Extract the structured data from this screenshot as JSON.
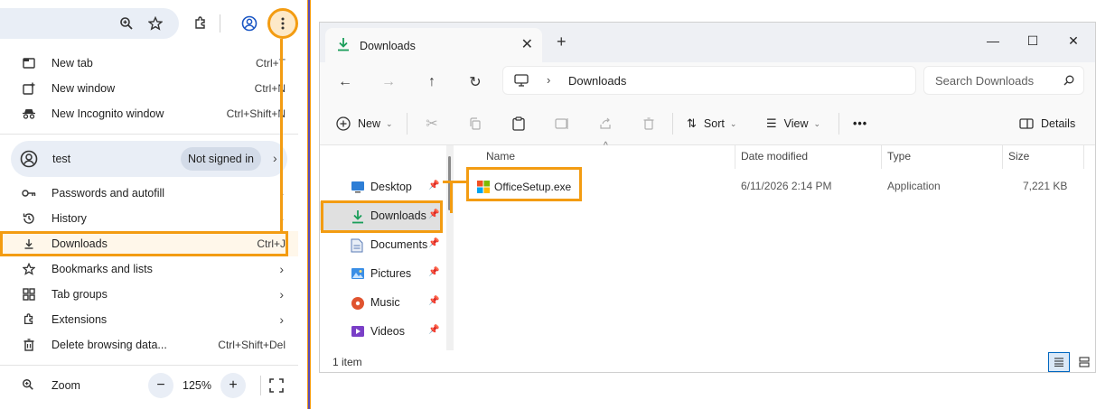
{
  "chrome": {
    "zoom": {
      "label": "Zoom",
      "value": "125%",
      "minus": "−",
      "plus": "+"
    },
    "menu_items_top": [
      {
        "label": "New tab",
        "shortcut": "Ctrl+T",
        "icon": "new-tab-icon"
      },
      {
        "label": "New window",
        "shortcut": "Ctrl+N",
        "icon": "new-window-icon"
      },
      {
        "label": "New Incognito window",
        "shortcut": "Ctrl+Shift+N",
        "icon": "incognito-icon"
      }
    ],
    "profile": {
      "name": "test",
      "status": "Not signed in",
      "icon": "profile-icon"
    },
    "menu_items": [
      {
        "label": "Passwords and autofill",
        "icon": "key-icon",
        "arrow": "›"
      },
      {
        "label": "History",
        "icon": "history-icon",
        "arrow": "›"
      },
      {
        "label": "Downloads",
        "shortcut": "Ctrl+J",
        "icon": "download-icon",
        "highlighted": true
      },
      {
        "label": "Bookmarks and lists",
        "icon": "star-icon",
        "arrow": "›"
      },
      {
        "label": "Tab groups",
        "icon": "tab-groups-icon",
        "arrow": "›"
      },
      {
        "label": "Extensions",
        "icon": "extensions-icon",
        "arrow": "›"
      },
      {
        "label": "Delete browsing data...",
        "shortcut": "Ctrl+Shift+Del",
        "icon": "trash-icon"
      }
    ]
  },
  "explorer": {
    "tab": {
      "label": "Downloads",
      "close": "✕",
      "new_tab": "+"
    },
    "window_controls": {
      "minimize": "—",
      "maximize": "☐",
      "close": "✕"
    },
    "address": {
      "path": "Downloads",
      "chevron": "›"
    },
    "search": {
      "placeholder": "Search Downloads"
    },
    "commands": {
      "new": "New",
      "sort": "Sort",
      "view": "View",
      "more": "•••",
      "details": "Details"
    },
    "nav_items": [
      {
        "label": "Desktop",
        "icon": "desktop-icon"
      },
      {
        "label": "Downloads",
        "icon": "download-icon",
        "selected": true
      },
      {
        "label": "Documents",
        "icon": "documents-icon"
      },
      {
        "label": "Pictures",
        "icon": "pictures-icon"
      },
      {
        "label": "Music",
        "icon": "music-icon"
      },
      {
        "label": "Videos",
        "icon": "videos-icon"
      }
    ],
    "columns": {
      "name": "Name",
      "date": "Date modified",
      "type": "Type",
      "size": "Size"
    },
    "files": [
      {
        "name": "OfficeSetup.exe",
        "date": "6/11/2026 2:14 PM",
        "type": "Application",
        "size": "7,221 KB",
        "icon": "office-icon"
      }
    ],
    "status": "1 item",
    "colors": {
      "highlight": "#f39c12",
      "accent": "#0067c0",
      "download_green": "#1a9e5a"
    }
  }
}
